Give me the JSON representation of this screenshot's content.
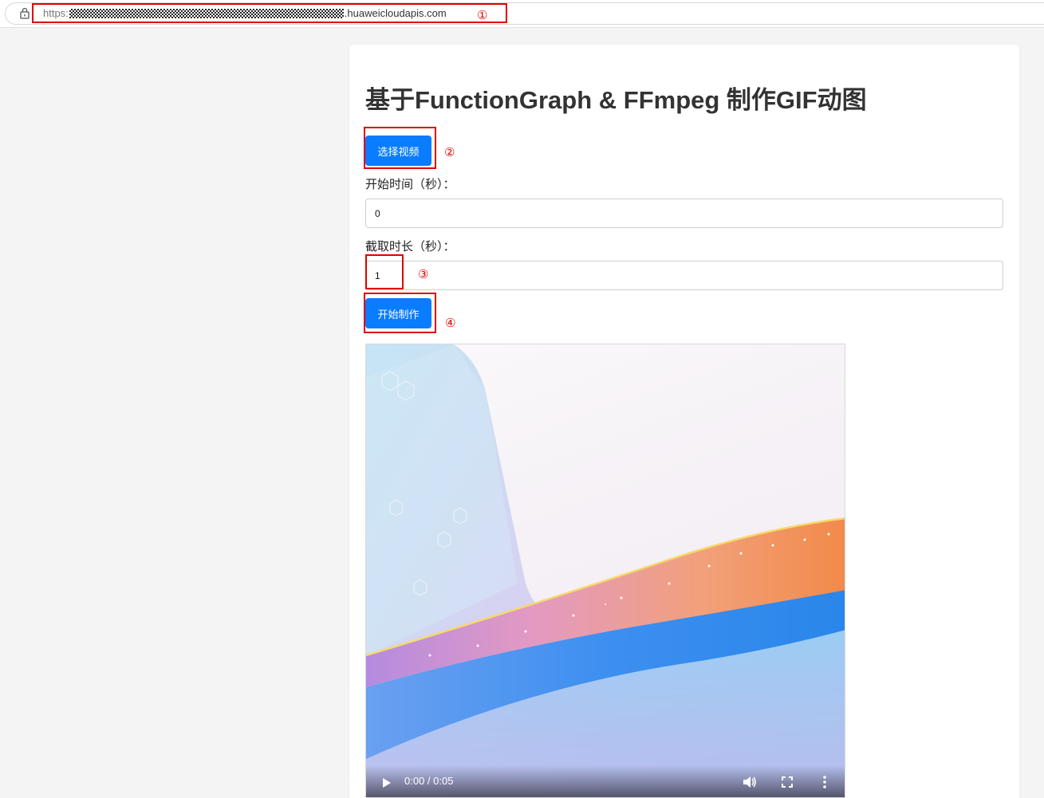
{
  "browser": {
    "url_scheme": "https:",
    "url_domain": ".huaweicloudapis.com"
  },
  "annotations": {
    "n1": "①",
    "n2": "②",
    "n3": "③",
    "n4": "④"
  },
  "page": {
    "title": "基于FunctionGraph & FFmpeg 制作GIF动图",
    "select_video_button": "选择视频",
    "start_time_label": "开始时间（秒）：",
    "start_time_value": "0",
    "duration_label": "截取时长（秒）：",
    "duration_value": "1",
    "start_button": "开始制作"
  },
  "video_player": {
    "time_display": "0:00 / 0:05",
    "play_icon": "play-icon",
    "volume_icon": "volume-icon",
    "fullscreen_icon": "fullscreen-icon",
    "more_icon": "more-vertical-icon"
  },
  "colors": {
    "primary_button": "#0a7cff",
    "annotation_red": "#e00000",
    "background": "#f4f4f4"
  }
}
